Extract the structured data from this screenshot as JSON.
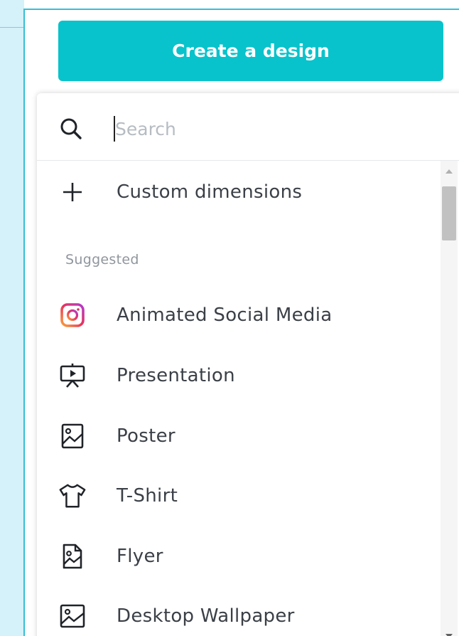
{
  "create_button": {
    "label": "Create a design"
  },
  "search": {
    "placeholder": "Search",
    "value": ""
  },
  "custom_dimensions": {
    "label": "Custom dimensions"
  },
  "section": {
    "suggested_label": "Suggested"
  },
  "items": [
    {
      "label": "Animated Social Media",
      "icon": "instagram-icon"
    },
    {
      "label": "Presentation",
      "icon": "presentation-icon"
    },
    {
      "label": "Poster",
      "icon": "poster-icon"
    },
    {
      "label": "T-Shirt",
      "icon": "tshirt-icon"
    },
    {
      "label": "Flyer",
      "icon": "flyer-icon"
    },
    {
      "label": "Desktop Wallpaper",
      "icon": "wallpaper-icon"
    }
  ],
  "colors": {
    "accent": "#08c3cb",
    "panel_border": "#35bfd4",
    "left_pane_bg": "#d5f1f9",
    "text": "#3b4047",
    "muted": "#8f969d"
  }
}
